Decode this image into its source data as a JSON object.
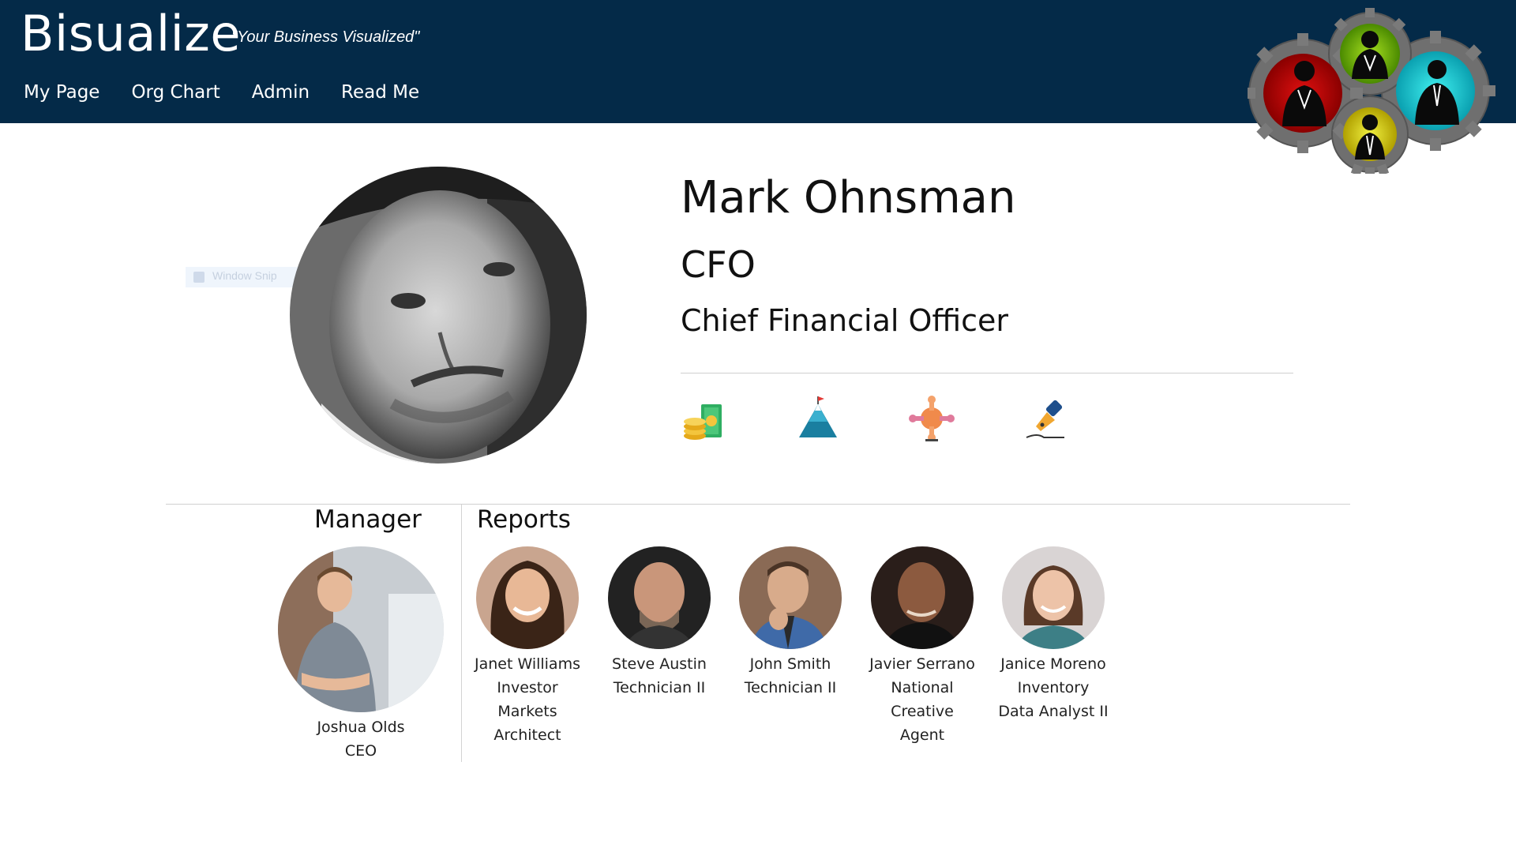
{
  "app": {
    "brand": "Bisualize",
    "tagline": "\"Your Business Visualized\""
  },
  "nav": {
    "items": [
      {
        "label": "My Page"
      },
      {
        "label": "Org Chart"
      },
      {
        "label": "Admin"
      },
      {
        "label": "Read Me"
      }
    ]
  },
  "overlay": {
    "snip_label": "Window Snip"
  },
  "profile": {
    "name": "Mark Ohnsman",
    "abbr": "CFO",
    "title": "Chief Financial Officer",
    "badges": [
      {
        "icon": "money-icon"
      },
      {
        "icon": "mountain-goal-icon"
      },
      {
        "icon": "teamwork-icon"
      },
      {
        "icon": "pen-signature-icon"
      }
    ]
  },
  "manager": {
    "heading": "Manager",
    "person": {
      "name": "Joshua Olds",
      "title": "CEO"
    }
  },
  "reports": {
    "heading": "Reports",
    "people": [
      {
        "name": "Janet Williams",
        "title": "Investor Markets Architect"
      },
      {
        "name": "Steve Austin",
        "title": "Technician II"
      },
      {
        "name": "John Smith",
        "title": "Technician II"
      },
      {
        "name": "Javier Serrano",
        "title": "National Creative Agent"
      },
      {
        "name": "Janice Moreno",
        "title": "Inventory Data Analyst II"
      }
    ]
  },
  "colors": {
    "header_bg": "#042a48",
    "text": "#111111",
    "divider": "#cfcfcf"
  }
}
